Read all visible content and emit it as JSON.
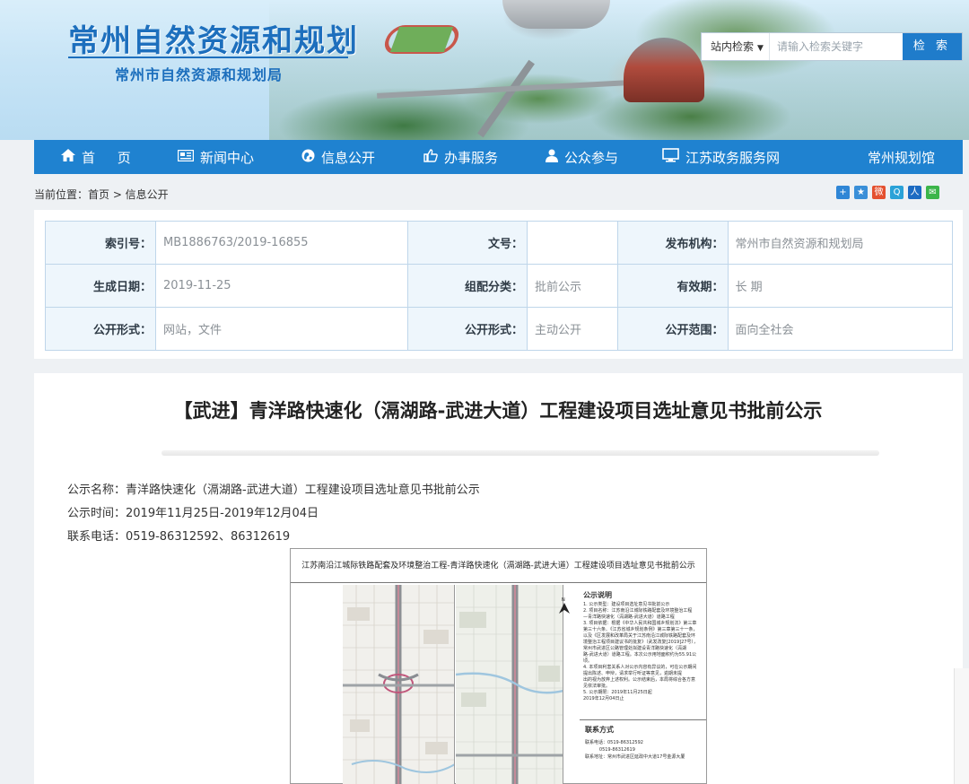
{
  "header": {
    "site_title": "常州自然资源和规划",
    "site_subtitle": "常州市自然资源和规划局",
    "search": {
      "scope": "站内检索",
      "placeholder": "请输入检索关键字",
      "button": "检 索"
    }
  },
  "nav": {
    "items": [
      {
        "label": "首 页",
        "icon": "home-icon"
      },
      {
        "label": "新闻中心",
        "icon": "newspaper-icon"
      },
      {
        "label": "信息公开",
        "icon": "globe-icon"
      },
      {
        "label": "办事服务",
        "icon": "thumbs-up-icon"
      },
      {
        "label": "公众参与",
        "icon": "user-icon"
      },
      {
        "label": "江苏政务服务网",
        "icon": "monitor-icon"
      },
      {
        "label": "常州规划馆",
        "icon": ""
      }
    ]
  },
  "breadcrumb": {
    "text": "当前位置：首页 > 信息公开"
  },
  "share_icons": [
    "plus-share-icon",
    "qzone-icon",
    "weibo-icon",
    "tqq-icon",
    "renren-icon",
    "wechat-icon"
  ],
  "meta": {
    "index_label": "索引号：",
    "index_value": "MB1886763/2019-16855",
    "doc_no_label": "文号：",
    "doc_no_value": "",
    "publisher_label": "发布机构：",
    "publisher_value": "常州市自然资源和规划局",
    "date_label": "生成日期：",
    "date_value": "2019-11-25",
    "category_label": "组配分类：",
    "category_value": "批前公示",
    "validity_label": "有效期：",
    "validity_value": "长 期",
    "form_label": "公开形式：",
    "form_value": "网站，文件",
    "form2_label": "公开形式：",
    "form2_value": "主动公开",
    "scope_label": "公开范围：",
    "scope_value": "面向全社会"
  },
  "article": {
    "title": "【武进】青洋路快速化（滆湖路-武进大道）工程建设项目选址意见书批前公示",
    "name_line": "公示名称：青洋路快速化（滆湖路-武进大道）工程建设项目选址意见书批前公示",
    "time_line": "公示时间：2019年11月25日-2019年12月04日",
    "phone_line": "联系电话：0519-86312592、86312619"
  },
  "poster": {
    "header": "江苏南沿江城际铁路配套及环境整治工程-青洋路快速化（滆湖路-武进大道）工程建设项目选址意见书批前公示",
    "notice_heading": "公示说明",
    "notice_lines": [
      "1. 公示类型：建设项目选址意见书批前公示",
      "2. 项目名称：江苏南沿江城际铁路配套及环境整治工程",
      "—青洋路快速化（滆湖路-武进大道）道路工程",
      "3. 项目依据：根据《中华人民共和国城乡规划法》第三章",
      "第三十六条、《江苏省城乡规划条例》第三章第三十一条，",
      "以及《区发展和改革局关于江苏南沿江城际铁路配套及环",
      "境整治工程项目建议书的批复》（武发改复[2019]27号），",
      "常州市武进区公路管理处拟建设青洋路快速化（滆湖",
      "路-武进大道）道路工程。本次公示用地面积约为55.91公顷。",
      "4. 本项目利害关系人对公示内容有异议的，可在公示期间",
      "提出陈述、申辩，请求举行听证等意见，逾期未提",
      "出的视为放弃上述权利。公示结束后，本局将综合各方意",
      "见依法审批。",
      "5. 公示期限：2019年11月25日起",
      "2019年12月04日止"
    ],
    "contact_heading": "联系方式",
    "contact_lines": [
      "联系电话：0519-86312592",
      "          0519-86312619",
      "联系地址：常州市武进区延政中大道17号金源大厦"
    ]
  }
}
